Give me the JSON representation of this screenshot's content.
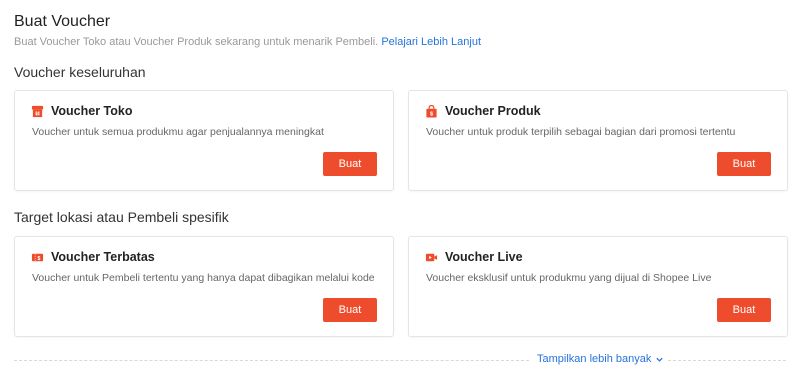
{
  "header": {
    "title": "Buat Voucher",
    "subtitle": "Buat Voucher Toko atau Voucher Produk sekarang untuk menarik Pembeli.",
    "learn_more": "Pelajari Lebih Lanjut"
  },
  "sections": [
    {
      "title": "Voucher keseluruhan",
      "cards": [
        {
          "title": "Voucher Toko",
          "desc": "Voucher untuk semua produkmu agar penjualannya meningkat",
          "button": "Buat",
          "icon": "shop-icon"
        },
        {
          "title": "Voucher Produk",
          "desc": "Voucher untuk produk terpilih sebagai bagian dari promosi tertentu",
          "button": "Buat",
          "icon": "shopping-bag-icon"
        }
      ]
    },
    {
      "title": "Target lokasi atau Pembeli spesifik",
      "cards": [
        {
          "title": "Voucher Terbatas",
          "desc": "Voucher untuk Pembeli tertentu yang hanya dapat dibagikan melalui kode",
          "button": "Buat",
          "icon": "coupon-icon"
        },
        {
          "title": "Voucher Live",
          "desc": "Voucher eksklusif untuk produkmu yang dijual di Shopee Live",
          "button": "Buat",
          "icon": "live-video-icon"
        }
      ]
    }
  ],
  "footer": {
    "show_more": "Tampilkan lebih banyak"
  },
  "colors": {
    "accent": "#ee4d2d",
    "link": "#2673dd"
  }
}
